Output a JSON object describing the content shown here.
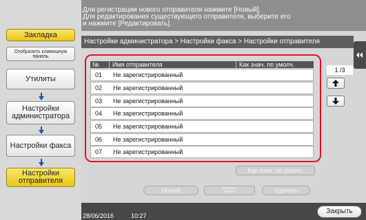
{
  "left_panel": {
    "bookmark": "Закладка",
    "show_keypad": "Отобразить клавишную панель",
    "utilities": "Утилиты",
    "admin_settings": "Настройки администратора",
    "fax_settings": "Настройки факса",
    "sender_settings": "Настройки отправителя"
  },
  "message": {
    "line1": "Для регистрации нового отправителя нажмите [Новый].",
    "line2": "Для редактирования существующего отправителя, выберите его",
    "line3": "и нажмите [Редактировать]."
  },
  "breadcrumb": "Настройки администратора > Настройки факса > Настройки отправителя",
  "table": {
    "col_no": "№",
    "col_name": "Имя отправителя",
    "col_default": "Как знач. по умолч.",
    "rows": [
      {
        "no": "01",
        "name": "Не зарегистрированный"
      },
      {
        "no": "02",
        "name": "Не зарегистрированный"
      },
      {
        "no": "03",
        "name": "Не зарегистрированный"
      },
      {
        "no": "04",
        "name": "Не зарегистрированный"
      },
      {
        "no": "05",
        "name": "Не зарегистрированный"
      },
      {
        "no": "06",
        "name": "Не зарегистрированный"
      },
      {
        "no": "07",
        "name": "Не зарегистрированный"
      }
    ]
  },
  "paging": {
    "indicator": "1 /3",
    "up_icon": "arrow-up-icon",
    "down_icon": "arrow-down-icon"
  },
  "buttons": {
    "set_default": "Как знач. по умолч.",
    "new": "Новый",
    "edit": "Редакти-ровать",
    "delete": "Удалить",
    "close": "Закрыть"
  },
  "status": {
    "date": "28/06/2016",
    "time": "10:27"
  },
  "colors": {
    "accent_yellow": "#f5d33a",
    "highlight_red": "#e0102a",
    "arrow_blue": "#1a55b0"
  }
}
